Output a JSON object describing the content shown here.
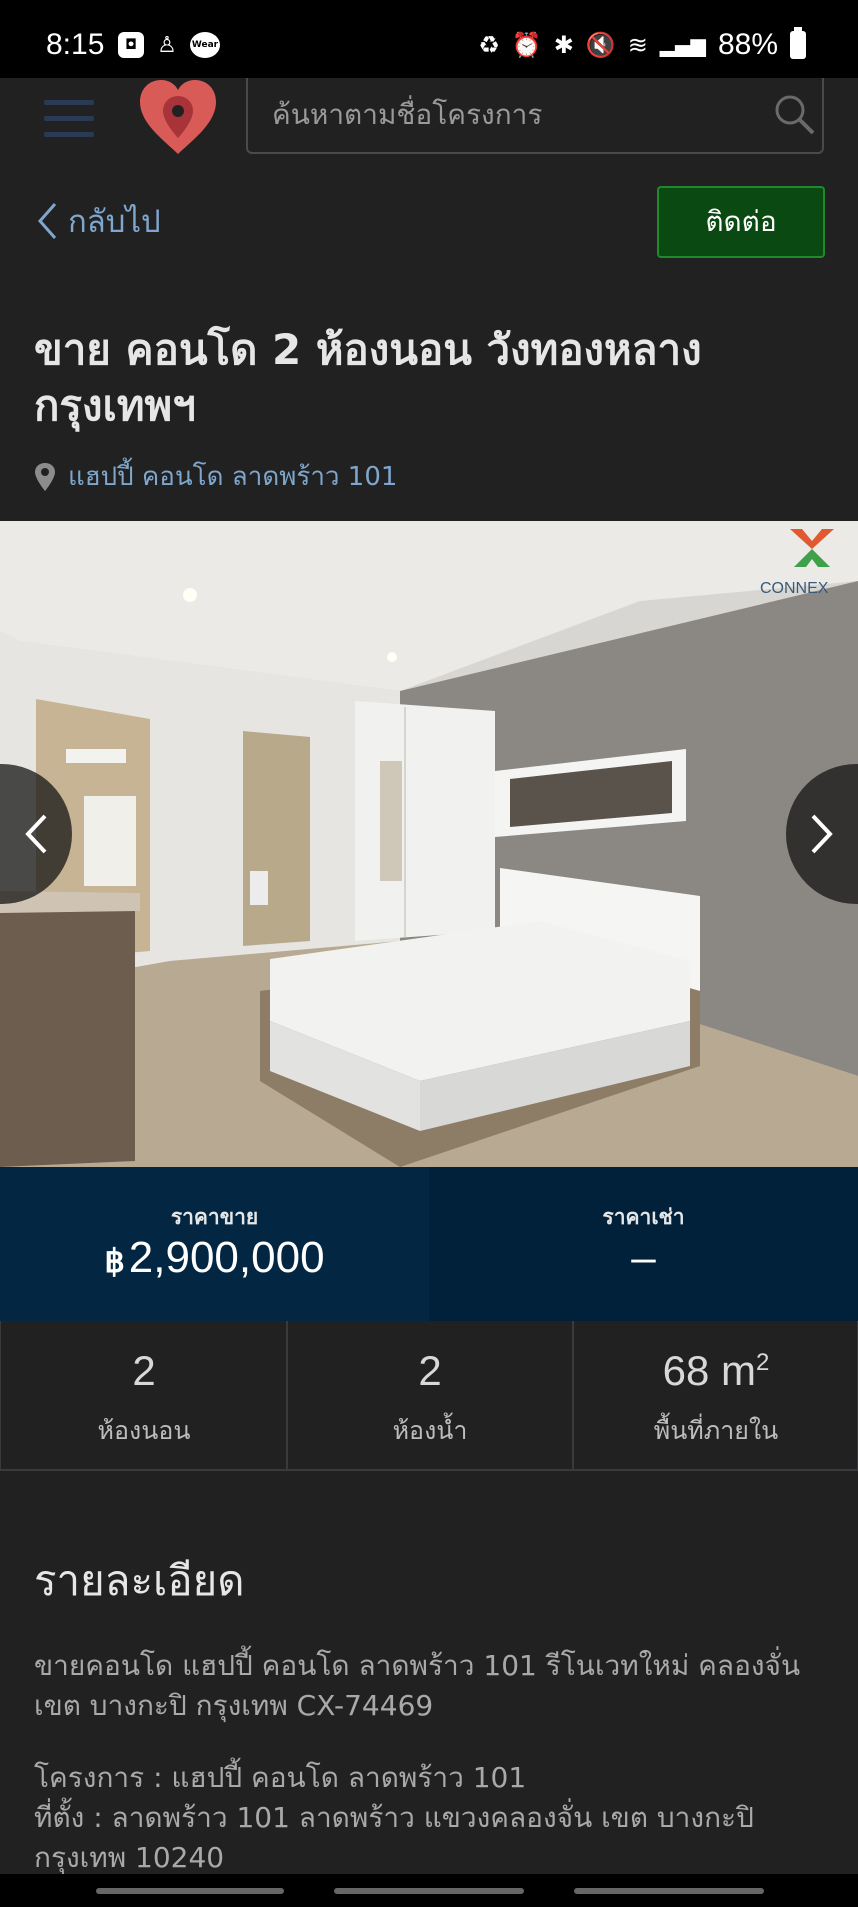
{
  "status_bar": {
    "time": "8:15",
    "left_icons": [
      "notification-icon",
      "app-icon",
      "wear-icon"
    ],
    "wear_label": "Wear",
    "right_glyphs": [
      "battery-saver-icon",
      "alarm-icon",
      "bluetooth-icon",
      "mute-icon",
      "wifi-icon",
      "volte-icon",
      "signal-icon"
    ],
    "battery": "88%"
  },
  "header": {
    "search_placeholder": "ค้นหาตามชื่อโครงการ",
    "brand_color": "#e0504f"
  },
  "back_label": "กลับไป",
  "contact_label": "ติดต่อ",
  "title": "ขาย คอนโด 2 ห้องนอน วังทองหลาง กรุงเทพฯ",
  "location": "แฮปปี้ คอนโด ลาดพร้าว 101",
  "gallery": {
    "watermark": "CONNEX"
  },
  "price": {
    "sale_label": "ราคาขาย",
    "sale_currency": "฿",
    "sale_value": "2,900,000",
    "rent_label": "ราคาเช่า",
    "rent_value": "–"
  },
  "stats": [
    {
      "value": "2",
      "label": "ห้องนอน"
    },
    {
      "value": "2",
      "label": "ห้องน้ำ"
    },
    {
      "value": "68",
      "unit": "m",
      "unit_sup": "2",
      "label": "พื้นที่ภายใน"
    }
  ],
  "details": {
    "heading": "รายละเอียด",
    "description": "ขายคอนโด แฮปปี้ คอนโด ลาดพร้าว 101 รีโนเวทใหม่ คลองจั่น เขต บางกะปิ กรุงเทพ CX-74469",
    "project_line": "โครงการ : แฮปปี้ คอนโด ลาดพร้าว 101",
    "address_line": "ที่ตั้ง : ลาดพร้าว 101 ลาดพร้าว แขวงคลองจั่น เขต บางกะปิ กรุงเทพ 10240"
  }
}
